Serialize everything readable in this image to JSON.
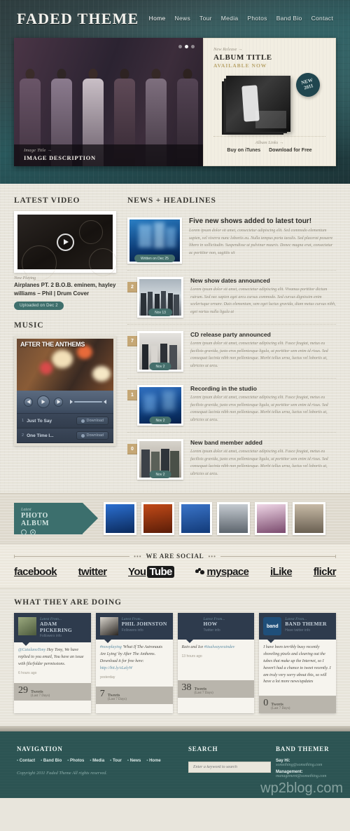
{
  "header": {
    "brand": "FADED THEME",
    "nav": [
      {
        "label": "Home",
        "active": true
      },
      {
        "label": "News",
        "active": false
      },
      {
        "label": "Tour",
        "active": false
      },
      {
        "label": "Media",
        "active": false
      },
      {
        "label": "Photos",
        "active": false
      },
      {
        "label": "Band Bio",
        "active": false
      },
      {
        "label": "Contact",
        "active": false
      }
    ]
  },
  "slider": {
    "caption_sub": "Image Title →",
    "caption_title": "IMAGE DESCRIPTION",
    "album": {
      "sub": "New Release →",
      "title": "ALBUM TITLE",
      "available": "AVAILABLE NOW",
      "badge_line1": "NEW",
      "badge_line2": "2011",
      "links_sub": "Album Links →",
      "link_itunes": "Buy on iTunes",
      "link_free": "Download for Free"
    }
  },
  "video": {
    "section_title": "LATEST VIDEO",
    "now_playing_label": "Now Playing",
    "title": "Airplanes PT. 2 B.O.B. eminem, hayley williams – Phil | Drum Cover",
    "uploaded_pill": "Uploaded on Dec 2",
    "play_icon": "play-icon"
  },
  "music": {
    "section_title": "MUSIC",
    "album_art_text": "AFTER THE ANTHEMS",
    "controls": {
      "prev": "prev-icon",
      "play": "play-icon",
      "next": "next-icon",
      "volume": "volume-icon"
    },
    "tracks": [
      {
        "num": "1",
        "name": "Just To Say",
        "download": "Download"
      },
      {
        "num": "2",
        "name": "One Time I...",
        "download": "Download"
      }
    ]
  },
  "news": {
    "section_title": "NEWS + HEADLINES",
    "items": [
      {
        "badge": "",
        "title": "Five new shows added to latest tour!",
        "date": "Written on Dec 25",
        "body": "Lorem ipsum dolor sit amet, consectetur adipiscing elit. Sed commodo elementum sapien, vel viverra nunc lobortis eu. Nulla tempus porta iaculis. Sed placerat posuere libero in sollicitudin. Suspendisse ut pulvinar mauris. Donec magna erat, consectetur ac porttitor non, sagittis sit",
        "thumb": "concert-stage-lights"
      },
      {
        "badge": "2",
        "title": "New show dates announced",
        "date": "Nov 13",
        "body": "Lorem ipsum dolor sit amet, consectetur adipiscing elit. Vivamus porttitor dictum rutrum. Sed nec sapien eget arcu cursus commodo. Sed cursus dignissim enim scelerisque ornare. Duis elementum, sem eget luctus gravida, diam metus cursus nibh, eget varius nulla ligula at",
        "thumb": "band-group-outdoor"
      },
      {
        "badge": "7",
        "title": "CD release party announced",
        "date": "Nov 2",
        "body": "Lorem ipsum dolor sit amet, consectetur adipiscing elit. Fusce feugiat, metus eu facilisis gravida, justo eros pellentesque ligula, ut porttitor sem enim id risus. Sed consequat lacinia nibh non pellentesque. Morbi tellus urna, luctus vel lobortis at, ultricies ut arcu.",
        "thumb": "band-group-bw"
      },
      {
        "badge": "1",
        "title": "Recording in the studio",
        "date": "Nov 2",
        "body": "Lorem ipsum dolor sit amet, consectetur adipiscing elit. Fusce feugiat, metus eu facilisis gravida, justo eros pellentesque ligula, ut porttitor sem enim id risus. Sed consequat lacinia nibh non pellentesque. Morbi tellus urna, luctus vel lobortis at, ultricies ut arcu.",
        "thumb": "blue-crowd"
      },
      {
        "badge": "0",
        "title": "New band member added",
        "date": "Nov 2",
        "body": "Lorem ipsum dolor sit amet, consectetur adipiscing elit. Fusce feugiat, metus eu facilisis gravida, justo eros pellentesque ligula, ut porttitor sem enim id risus. Sed consequat lacinia nibh non pellentesque. Morbi tellus urna, luctus vel lobortis at, ultricies ut arcu.",
        "thumb": "band-four-members"
      }
    ]
  },
  "photo_album": {
    "tag_sub": "Latest",
    "tag_title": "PHOTO ALBUM",
    "thumbs": [
      {
        "name": "blue-crowd-1",
        "c1": "#1d4f8f",
        "c2": "#0b2a5c"
      },
      {
        "name": "orange-stage",
        "c1": "#c24a18",
        "c2": "#5a1d08"
      },
      {
        "name": "blue-crowd-2",
        "c1": "#2a62b4",
        "c2": "#123a78"
      },
      {
        "name": "band-outdoor",
        "c1": "#b9bfc4",
        "c2": "#5d656d"
      },
      {
        "name": "pink-stage",
        "c1": "#d7a8c8",
        "c2": "#7a4a6d"
      },
      {
        "name": "band-portrait",
        "c1": "#b7a893",
        "c2": "#6a6052"
      }
    ]
  },
  "social": {
    "heading": "WE ARE SOCIAL",
    "dots_left": "•••",
    "dots_right": "•••",
    "networks": [
      {
        "label": "facebook",
        "name": "facebook-logo"
      },
      {
        "label": "twitter",
        "name": "twitter-logo"
      },
      {
        "label": "YouTube",
        "name": "youtube-logo",
        "part1": "You",
        "part2": "Tube"
      },
      {
        "label": "myspace",
        "name": "myspace-logo"
      },
      {
        "label": "iLike",
        "name": "ilike-logo"
      },
      {
        "label": "flickr",
        "name": "flickr-logo"
      }
    ]
  },
  "doing": {
    "section_title": "WHAT THEY ARE DOING",
    "cards": [
      {
        "handle": "Latest From...",
        "name": "ADAM PICKERING",
        "followers": "Followers info",
        "mention": "@CatalanoTony",
        "text": " Hey Tony, We have replied to you email, You have an issue with file/folder permissions.",
        "link": "",
        "ago": "6 hours ago",
        "count": "29",
        "count_label": "Tweets",
        "count_sub": "(Last 7 Days)",
        "avatar": "adam-avatar"
      },
      {
        "handle": "Latest From...",
        "name": "PHIL JOHNSTON",
        "followers": "Followers info",
        "mention": "#nowplaying",
        "text": " 'What If The Astronauts Are Lying' by After The Anthems. Download it for free here: ",
        "link": "http://bit.ly/sLalyW",
        "ago": "yesterday",
        "count": "7",
        "count_label": "Tweets",
        "count_sub": "(Last 7 Days)",
        "avatar": "phil-avatar"
      },
      {
        "handle": "Latest From...",
        "name": "HOW",
        "followers": "Twitter info",
        "mention": "Rain and Ice",
        "text": " ",
        "link": "#itsalwaysraindev",
        "ago": "13 hours ago",
        "count": "38",
        "count_label": "Tweets",
        "count_sub": "(Last 7 Days)",
        "avatar": "how-avatar"
      },
      {
        "handle": "Latest From...",
        "name": "BAND THEMER",
        "followers": "Have twitter info",
        "mention": "",
        "text": "I have been terribly busy recently shoveling pixels and clearing out the tubes that make up the Internet, so I haven't had a chance to tweet recently. I am truly very sorry about this, so will have a lot more news/updates",
        "link": "",
        "ago": "",
        "count": "0",
        "count_label": "Tweets",
        "count_sub": "(Last 7 Days)",
        "avatar": "band-logo-avatar"
      }
    ]
  },
  "footer": {
    "nav_title": "NAVIGATION",
    "nav_links": [
      "Contact",
      "Band Bio",
      "Photos",
      "Media",
      "Tour",
      "News",
      "Home"
    ],
    "copyright": "Copyright 2011 Faded Theme All rights reserved.",
    "search_title": "SEARCH",
    "search_placeholder": "Enter a keyword to search",
    "bt_title": "BAND THEMER",
    "say_hi_label": "Say Hi:",
    "say_hi_value": "something@something.com",
    "mgmt_label": "Management:",
    "mgmt_value": "management@something.com",
    "watermark": "wp2blog.com"
  },
  "colors": {
    "teal": "#2c5453",
    "pill_teal": "#456f6c",
    "badge_tan": "#c5a775",
    "paper": "#e7e4da",
    "dark_navy": "#2e3b4d"
  }
}
